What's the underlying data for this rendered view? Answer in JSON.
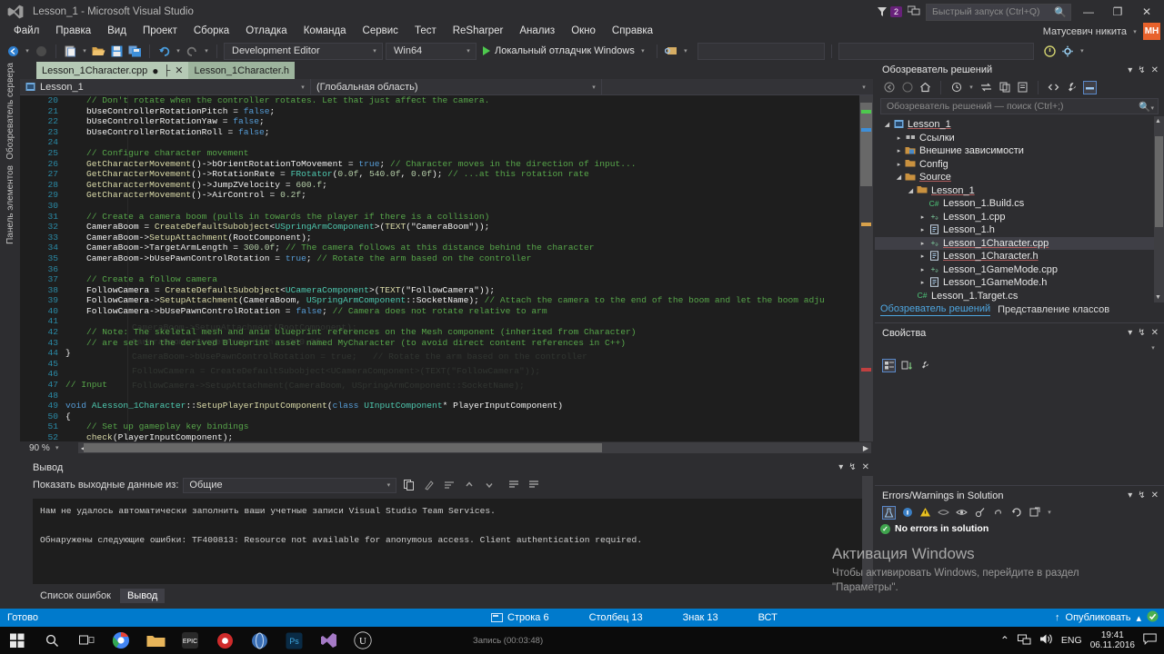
{
  "window": {
    "title": "Lesson_1 - Microsoft Visual Studio",
    "logo_icon": "visual-studio-logo",
    "minimize_icon": "—",
    "restore_icon": "❐",
    "close_icon": "✕",
    "feedback_icon": "feedback-icon",
    "notification_count": "2"
  },
  "quick_launch": {
    "placeholder": "Быстрый запуск (Ctrl+Q)",
    "value": "",
    "icon": "search-icon"
  },
  "account": {
    "name": "Матусевич никита",
    "initials": "МН",
    "chevron": "▾"
  },
  "menu": {
    "items": [
      {
        "label": "Файл"
      },
      {
        "label": "Правка"
      },
      {
        "label": "Вид"
      },
      {
        "label": "Проект"
      },
      {
        "label": "Сборка"
      },
      {
        "label": "Отладка"
      },
      {
        "label": "Команда"
      },
      {
        "label": "Сервис"
      },
      {
        "label": "Тест"
      },
      {
        "label": "ReSharper"
      },
      {
        "label": "Анализ"
      },
      {
        "label": "Окно"
      },
      {
        "label": "Справка"
      }
    ]
  },
  "toolbar": {
    "back_icon": "navigate-back-icon",
    "forward_icon": "navigate-forward-icon",
    "new_project_icon": "new-project-icon",
    "open_icon": "open-file-icon",
    "save_icon": "save-icon",
    "save_all_icon": "save-all-icon",
    "undo_icon": "undo-icon",
    "redo_icon": "redo-icon",
    "configuration": "Development Editor",
    "platform": "Win64",
    "run_label": "Локальный отладчик Windows",
    "run_icon": "play-icon",
    "attach_icon": "attach-to-process-icon",
    "find_placeholder": "",
    "dropdown_caret": "▾"
  },
  "left_docks": [
    {
      "label": "Обозреватель сервера"
    },
    {
      "label": "Панель элементов"
    }
  ],
  "editor_tabs": [
    {
      "label": "Lesson_1Character.cpp",
      "modified": "●",
      "pin_icon": "pin-icon",
      "close_icon": "✕",
      "active": true
    },
    {
      "label": "Lesson_1Character.h",
      "active": false
    }
  ],
  "nav_bar": {
    "project": "Lesson_1",
    "project_icon": "cpp-project-icon",
    "scope": "(Глобальная область)",
    "member": "",
    "caret": "▾"
  },
  "editor": {
    "zoom": "90 %",
    "vertical_scroll": "editor-vertical-scrollbar",
    "horizontal_scroll": "editor-horizontal-scrollbar",
    "lines": [
      {
        "n": "20",
        "text": "    // Don't rotate when the controller rotates. Let that just affect the camera.",
        "cls": "c"
      },
      {
        "n": "21",
        "text": "    bUseControllerRotationPitch = false;",
        "cls": "w"
      },
      {
        "n": "22",
        "text": "    bUseControllerRotationYaw = false;",
        "cls": "w"
      },
      {
        "n": "23",
        "text": "    bUseControllerRotationRoll = false;",
        "cls": "w"
      },
      {
        "n": "24",
        "text": "",
        "cls": "w"
      },
      {
        "n": "25",
        "text": "    // Configure character movement",
        "cls": "c"
      },
      {
        "n": "26",
        "text": "    GetCharacterMovement()->bOrientRotationToMovement = true; // Character moves in the direction of input...",
        "cls": "w"
      },
      {
        "n": "27",
        "text": "    GetCharacterMovement()->RotationRate = FRotator(0.0f, 540.0f, 0.0f); // ...at this rotation rate",
        "cls": "w"
      },
      {
        "n": "28",
        "text": "    GetCharacterMovement()->JumpZVelocity = 600.f;",
        "cls": "w"
      },
      {
        "n": "29",
        "text": "    GetCharacterMovement()->AirControl = 0.2f;",
        "cls": "w"
      },
      {
        "n": "30",
        "text": "",
        "cls": "w"
      },
      {
        "n": "31",
        "text": "    // Create a camera boom (pulls in towards the player if there is a collision)",
        "cls": "c"
      },
      {
        "n": "32",
        "text": "    CameraBoom = CreateDefaultSubobject<USpringArmComponent>(TEXT(\"CameraBoom\"));",
        "cls": "w"
      },
      {
        "n": "33",
        "text": "    CameraBoom->SetupAttachment(RootComponent);",
        "cls": "w"
      },
      {
        "n": "34",
        "text": "    CameraBoom->TargetArmLength = 300.0f; // The camera follows at this distance behind the character",
        "cls": "w"
      },
      {
        "n": "35",
        "text": "    CameraBoom->bUsePawnControlRotation = true; // Rotate the arm based on the controller",
        "cls": "w"
      },
      {
        "n": "36",
        "text": "",
        "cls": "w"
      },
      {
        "n": "37",
        "text": "    // Create a follow camera",
        "cls": "c"
      },
      {
        "n": "38",
        "text": "    FollowCamera = CreateDefaultSubobject<UCameraComponent>(TEXT(\"FollowCamera\"));",
        "cls": "w"
      },
      {
        "n": "39",
        "text": "    FollowCamera->SetupAttachment(CameraBoom, USpringArmComponent::SocketName); // Attach the camera to the end of the boom and let the boom adju",
        "cls": "w"
      },
      {
        "n": "40",
        "text": "    FollowCamera->bUsePawnControlRotation = false; // Camera does not rotate relative to arm",
        "cls": "w"
      },
      {
        "n": "41",
        "text": "",
        "cls": "w"
      },
      {
        "n": "42",
        "text": "    // Note: The skeletal mesh and anim blueprint references on the Mesh component (inherited from Character)",
        "cls": "c"
      },
      {
        "n": "43",
        "text": "    // are set in the derived Blueprint asset named MyCharacter (to avoid direct content references in C++)",
        "cls": "c"
      },
      {
        "n": "44",
        "text": "}",
        "cls": "w"
      },
      {
        "n": "45",
        "text": "",
        "cls": "w"
      },
      {
        "n": "46",
        "text": "",
        "cls": "w"
      },
      {
        "n": "47",
        "text": "// Input",
        "cls": "c"
      },
      {
        "n": "48",
        "text": "",
        "cls": "w"
      },
      {
        "n": "49",
        "text": "void ALesson_1Character::SetupPlayerInputComponent(class UInputComponent* PlayerInputComponent)",
        "cls": "w"
      },
      {
        "n": "50",
        "text": "{",
        "cls": "w"
      },
      {
        "n": "51",
        "text": "    // Set up gameplay key bindings",
        "cls": "c"
      },
      {
        "n": "52",
        "text": "    check(PlayerInputComponent);",
        "cls": "w"
      }
    ],
    "ghost_lines": [
      "    CameraBoom->SetupAttachment(RootComponent);",
      "    CameraBoom->TargetArmLength = 300.0f;",
      "    CameraBoom->bUsePawnControlRotation = true;   // Rotate the arm based on the controller",
      "    FollowCamera = CreateDefaultSubobject<UCameraComponent>(TEXT(\"FollowCamera\"));",
      "    FollowCamera->SetupAttachment(CameraBoom, USpringArmComponent::SocketName);"
    ]
  },
  "output": {
    "title": "Вывод",
    "source_label": "Показать выходные данные из:",
    "source_value": "Общие",
    "caret": "▾",
    "toolbar_icons": [
      "copy-output-icon",
      "clear-output-icon",
      "toggle-wordwrap-icon",
      "go-to-previous-icon",
      "go-to-next-icon",
      "find-message-icon",
      "find-next-icon"
    ],
    "lines": [
      "Нам не удалось автоматически заполнить ваши учетные записи Visual Studio Team Services.",
      "",
      "Обнаружены следующие ошибки: TF400813: Resource not available for anonymous access. Client authentication required."
    ],
    "tabs": [
      {
        "label": "Список ошибок",
        "active": false
      },
      {
        "label": "Вывод",
        "active": true
      }
    ],
    "minimize_icon": "▾",
    "pin_icon": "↯",
    "close_icon": "✕"
  },
  "solution_explorer": {
    "title": "Обозреватель решений",
    "search_placeholder": "Обозреватель решений — поиск (Ctrl+;)",
    "search_icon": "search-icon",
    "toolbar_icons": [
      "back-icon",
      "forward-icon",
      "home-icon",
      "pending-changes-icon",
      "sync-with-active-document-icon",
      "refresh-icon",
      "collapse-all-icon",
      "show-all-files-icon",
      "view-code-icon",
      "properties-icon",
      "preview-selected-items-icon"
    ],
    "menu_icon": "▾",
    "pin_icon": "↯",
    "close_icon": "✕",
    "tree": [
      {
        "indent": 0,
        "expander": "◢",
        "icon": "solution-icon",
        "label": "Lesson_1",
        "selected": false,
        "underline": true
      },
      {
        "indent": 1,
        "expander": "▸",
        "icon": "references-icon",
        "label": "Ссылки",
        "selected": false,
        "underline": false
      },
      {
        "indent": 1,
        "expander": "▸",
        "icon": "external-dependencies-icon",
        "label": "Внешние зависимости",
        "selected": false,
        "underline": false
      },
      {
        "indent": 1,
        "expander": "▸",
        "icon": "folder-icon",
        "label": "Config",
        "selected": false,
        "underline": false
      },
      {
        "indent": 1,
        "expander": "◢",
        "icon": "folder-icon",
        "label": "Source",
        "selected": false,
        "underline": true
      },
      {
        "indent": 2,
        "expander": "◢",
        "icon": "folder-icon",
        "label": "Lesson_1",
        "selected": false,
        "underline": true
      },
      {
        "indent": 3,
        "expander": "",
        "icon": "cs-file-icon",
        "label": "Lesson_1.Build.cs",
        "selected": false,
        "underline": false
      },
      {
        "indent": 3,
        "expander": "▸",
        "icon": "cpp-file-icon",
        "label": "Lesson_1.cpp",
        "selected": false,
        "underline": false
      },
      {
        "indent": 3,
        "expander": "▸",
        "icon": "h-file-icon",
        "label": "Lesson_1.h",
        "selected": false,
        "underline": false
      },
      {
        "indent": 3,
        "expander": "▸",
        "icon": "cpp-file-icon",
        "label": "Lesson_1Character.cpp",
        "selected": true,
        "underline": true
      },
      {
        "indent": 3,
        "expander": "▸",
        "icon": "h-file-icon",
        "label": "Lesson_1Character.h",
        "selected": false,
        "underline": true
      },
      {
        "indent": 3,
        "expander": "▸",
        "icon": "cpp-file-icon",
        "label": "Lesson_1GameMode.cpp",
        "selected": false,
        "underline": false
      },
      {
        "indent": 3,
        "expander": "▸",
        "icon": "h-file-icon",
        "label": "Lesson_1GameMode.h",
        "selected": false,
        "underline": false
      },
      {
        "indent": 2,
        "expander": "",
        "icon": "cs-file-icon",
        "label": "Lesson_1.Target.cs",
        "selected": false,
        "underline": false
      }
    ],
    "tabs": [
      {
        "label": "Обозреватель решений",
        "active": true
      },
      {
        "label": "Представление классов",
        "active": false
      }
    ]
  },
  "properties": {
    "title": "Свойства",
    "menu_icon": "▾",
    "pin_icon": "↯",
    "close_icon": "✕",
    "object_caret": "▾",
    "toolbar_icons": [
      "categorized-icon",
      "alphabetical-icon",
      "property-pages-icon"
    ]
  },
  "errors_panel": {
    "title": "Errors/Warnings in Solution",
    "menu_icon": "▾",
    "pin_icon": "↯",
    "close_icon": "✕",
    "toolbar_icons": [
      "analyze-icon",
      "info-icon",
      "warning-icon",
      "hide-icon",
      "show-icon",
      "filter-icon",
      "link-icon",
      "refresh-icon",
      "open-external-icon"
    ],
    "status_text": "No errors in solution",
    "status_icon": "check-circle-icon"
  },
  "watermark": {
    "line1": "Активация Windows",
    "line2": "Чтобы активировать Windows, перейдите в раздел",
    "line3": "\"Параметры\"."
  },
  "status_bar": {
    "ready": "Готово",
    "line_icon": "caret-position-icon",
    "line": "Строка 6",
    "column": "Столбец 13",
    "char": "Знак 13",
    "insert_mode": "ВСТ",
    "publish": "Опубликовать",
    "publish_arrow": "↑",
    "publish_caret": "▴",
    "source_control_icon": "source-control-ok-icon"
  },
  "taskbar": {
    "start_icon": "windows-start-icon",
    "search_icon": "search-icon",
    "task_view_icon": "task-view-icon",
    "apps": [
      "chrome-icon",
      "folder-icon",
      "epic-games-icon",
      "record-icon",
      "browser-icon",
      "photoshop-icon",
      "visual-studio-icon",
      "unreal-engine-icon"
    ],
    "record_note": "Запись (00:03:48)",
    "tray": {
      "chevron": "⌃",
      "network_icon": "network-icon",
      "volume_icon": "volume-icon",
      "language": "ENG",
      "time": "19:41",
      "date": "06.11.2016",
      "action_center_icon": "action-center-icon"
    }
  }
}
